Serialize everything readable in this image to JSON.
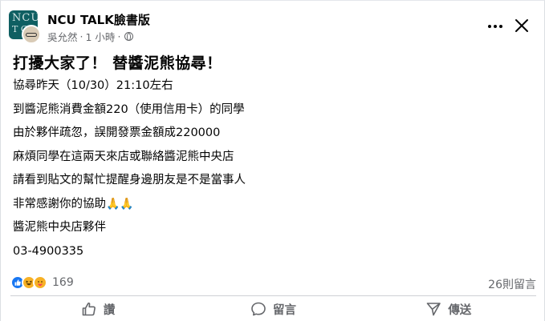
{
  "post": {
    "page_name": "NCU TALK臉書版",
    "author": "吳允然",
    "separator": "·",
    "time": "1 小時",
    "privacy_icon": "globe-icon",
    "title": "打擾大家了！ 替醬泥熊協尋！",
    "lines": [
      "協尋昨天（10/30）21:10左右",
      "到醬泥熊消費金額220（使用信用卡）的同學",
      "由於夥伴疏忽，誤開發票金額成220000",
      "麻煩同學在這兩天來店或聯絡醬泥熊中央店",
      "請看到貼文的幫忙提醒身邊朋友是不是當事人",
      "非常感謝你的協助",
      "醬泥熊中央店夥伴",
      "03-4900335"
    ],
    "pray_emoji": "🙏🙏"
  },
  "stats": {
    "reaction_icons": [
      "like-icon",
      "haha-icon",
      "care-icon"
    ],
    "reaction_count": "169",
    "comment_count": "26則留言"
  },
  "actions": {
    "like": "讚",
    "comment": "留言",
    "share": "傳送"
  },
  "colors": {
    "like_blue": "#1877f2",
    "secondary_text": "#65676b",
    "reaction_yellow": "#f7b125"
  }
}
